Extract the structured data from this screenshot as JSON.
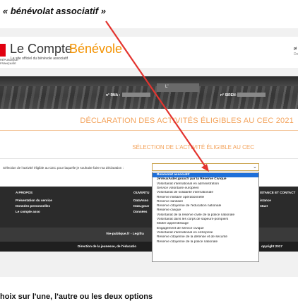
{
  "annotation": {
    "caption": "« bénévolat associatif »",
    "arrow_color": "#e3342f"
  },
  "header": {
    "brand_part1": "Le Compte",
    "brand_part2": "Bénévole",
    "subtitle": "Le site officiel du bénévole associatif",
    "rf_text": "RÉPUBLIQUE FRANÇAISE",
    "right_cut_1": "pi",
    "right_cut_2": "De"
  },
  "banner": {
    "card_text": "L'",
    "rna_label": "n° RNA :",
    "siren_label": "n° SIREN :"
  },
  "page": {
    "declaration_title": "DÉCLARATION DES ACTIVITÉS ÉLIGIBLES AU CEC 2021",
    "select_title": "SÉLECTION DE L'ACTIVITÉ ÉLIGIBLE AU CEC",
    "field_label": "Sélection de l'activité éligible au CEC pour laquelle je souhaite faire ma déclaration :",
    "select_value": ""
  },
  "dropdown": {
    "options": [
      "Bénévolat associatif",
      "JeVeuxAider.gouv.fr par la Réserve Civique",
      "Volontariat international en administration",
      "Service volontaire européen",
      "Volontariat de solidarité internationale",
      "Réserve militaire opérationnelle",
      "Réserve sanitaire",
      "Réserve citoyenne de l'éducation nationale",
      "Réserve civique",
      "Volontariat de la réserve civile de la police nationale",
      "Volontariat dans les corps de sapeurs-pompiers",
      "Maître apprentissage",
      "Engagement de service civique",
      "Volontariat international en entreprise",
      "Réserve citoyenne de la défense et de sécurité",
      "Réserve citoyenne de la police nationale"
    ],
    "selected_index": 0,
    "selected_color": "#1e6fd9"
  },
  "footer": {
    "col1_head": "A PROPOS",
    "col1_links": [
      "Présentation du service",
      "Données personnelles",
      "Le compte asso"
    ],
    "col2_head": "OUVERTU",
    "col2_links": [
      "DataAsso",
      "Data.gouv",
      "Données"
    ],
    "col3_head": "ISTANCE ET CONTACT",
    "col3_links": [
      "istance",
      "ntact"
    ],
    "vie_publique": "Vie-publique.fr - Legifra",
    "direction": "Direction de la jeunesse, de l'éducatio",
    "copyright": "opyright 2017"
  },
  "bottom_text": "hoix sur l'une, l'autre ou les deux options"
}
